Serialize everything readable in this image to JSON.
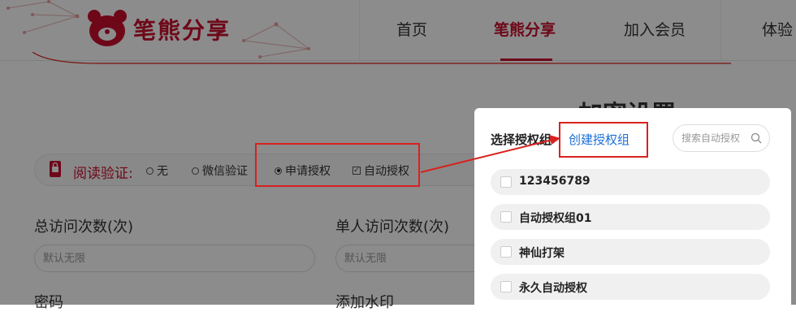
{
  "header": {
    "logo_text": "笔熊分享",
    "nav": [
      {
        "label": "首页"
      },
      {
        "label": "笔熊分享"
      },
      {
        "label": "加入会员"
      },
      {
        "label": "体验"
      }
    ]
  },
  "page": {
    "title": "加密设置",
    "verify": {
      "label": "阅读验证:",
      "options": [
        {
          "label": "无",
          "state": "off"
        },
        {
          "label": "微信验证",
          "state": "off"
        },
        {
          "label": "申请授权",
          "state": "on"
        },
        {
          "label": "自动授权",
          "state": "checked"
        }
      ]
    },
    "fields": {
      "total_visits_label": "总访问次数(次)",
      "total_visits_placeholder": "默认无限",
      "single_visits_label": "单人访问次数(次)",
      "single_visits_placeholder": "默认无限",
      "password_label": "密码",
      "watermark_label": "添加水印"
    }
  },
  "popup": {
    "title": "选择授权组",
    "create_link": "创建授权组",
    "search_placeholder": "搜索自动授权",
    "groups": [
      {
        "label": "123456789"
      },
      {
        "label": "自动授权组01"
      },
      {
        "label": "神仙打架"
      },
      {
        "label": "永久自动授权"
      }
    ]
  },
  "colors": {
    "brand": "#c8102e",
    "link": "#1a6fd8",
    "annotation": "#d9211e"
  }
}
